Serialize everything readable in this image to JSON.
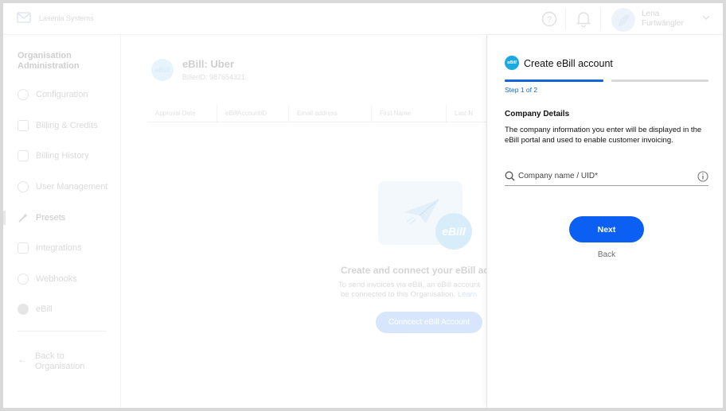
{
  "header": {
    "company_name": "Lasenia Systems",
    "user_name": "Lena Furtwängler"
  },
  "sidebar": {
    "title": "Organisation Administration",
    "items": [
      {
        "label": "Configuration",
        "icon": "gear-icon"
      },
      {
        "label": "Billing & Credits",
        "icon": "wallet-icon"
      },
      {
        "label": "Billing History",
        "icon": "history-icon"
      },
      {
        "label": "User Management",
        "icon": "users-icon"
      },
      {
        "label": "Presets",
        "icon": "wand-icon"
      },
      {
        "label": "Integrations",
        "icon": "integrations-icon"
      },
      {
        "label": "Webhooks",
        "icon": "webhook-icon"
      },
      {
        "label": "eBill",
        "icon": "ebill-icon"
      }
    ],
    "active_item": "Presets",
    "back_label": "Back to Organisation"
  },
  "main": {
    "logo_text": "eBill",
    "title": "eBill: Uber",
    "biller_id": "BillerID: 987654321",
    "table_headers": [
      "Approval Date",
      "eBillAccountID",
      "Email address",
      "First Name",
      "Last N"
    ],
    "empty_badge": "eBill",
    "empty_title": "Create and connect your eBill acco",
    "empty_text_line1": "To send invoices via eBill, an eBill account",
    "empty_text_line2": "be connected to this Organisation.",
    "empty_link": "Learn",
    "connect_button": "Conncect eBill Account"
  },
  "drawer": {
    "logo_text": "eBill",
    "title": "Create eBill account",
    "step": "Step 1 of 2",
    "progress": 0.5,
    "section_title": "Company Details",
    "section_desc": "The company information you enter will be displayed in the eBill portal and used to enable customer invoicing.",
    "input_placeholder": "Company name / UID*",
    "input_value": "",
    "next_button": "Next",
    "back_button": "Back"
  },
  "colors": {
    "primary": "#0b5ff2",
    "progress_active": "#1565d8",
    "ebill_brand": "#1ba9e0"
  }
}
